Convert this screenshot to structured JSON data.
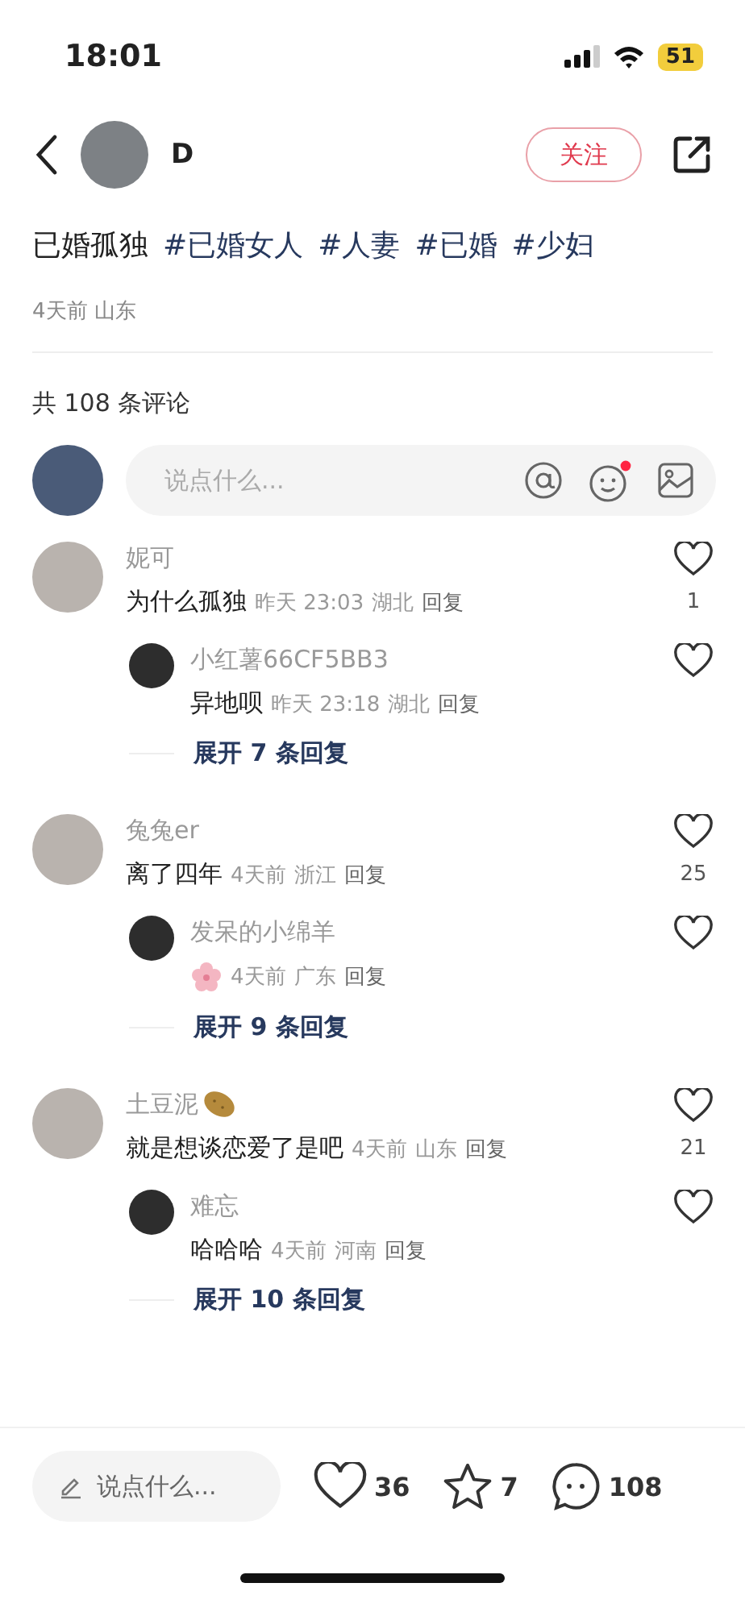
{
  "status_bar": {
    "time": "18:01",
    "battery": "51"
  },
  "header": {
    "author": "D",
    "follow_label": "关注"
  },
  "post": {
    "title_parts": [
      {
        "text": "已婚孤独",
        "kind": "plain"
      },
      {
        "text": "#已婚女人",
        "kind": "tag"
      },
      {
        "text": "#人妻",
        "kind": "tag"
      },
      {
        "text": "#已婚",
        "kind": "tag"
      },
      {
        "text": "#少妇",
        "kind": "tag"
      }
    ],
    "date": "4天前",
    "location": "山东"
  },
  "comments_count": "共 108 条评论",
  "comment_input": {
    "placeholder": "说点什么..."
  },
  "comments": [
    {
      "name": "妮可",
      "text": "为什么孤独",
      "time": "昨天 23:03",
      "location": "湖北",
      "reply_label": "回复",
      "likes": "1",
      "replies": [
        {
          "name": "小红薯66CF5BB3",
          "text": "异地呗",
          "time": "昨天 23:18",
          "location": "湖北",
          "reply_label": "回复"
        }
      ],
      "expand": "展开 7 条回复"
    },
    {
      "name": "兔兔er",
      "text": "离了四年",
      "time": "4天前",
      "location": "浙江",
      "reply_label": "回复",
      "likes": "25",
      "replies": [
        {
          "name": "发呆的小绵羊",
          "flower_sticker": true,
          "time": "4天前",
          "location": "广东",
          "reply_label": "回复"
        }
      ],
      "expand": "展开 9 条回复"
    },
    {
      "name": "土豆泥",
      "potato_sticker": true,
      "text": "就是想谈恋爱了是吧",
      "time": "4天前",
      "location": "山东",
      "reply_label": "回复",
      "likes": "21",
      "replies": [
        {
          "name": "难忘",
          "text": "哈哈哈",
          "time": "4天前",
          "location": "河南",
          "reply_label": "回复"
        }
      ],
      "expand": "展开 10 条回复"
    }
  ],
  "bottom_bar": {
    "placeholder": "说点什么...",
    "likes": "36",
    "stars": "7",
    "comments": "108"
  }
}
